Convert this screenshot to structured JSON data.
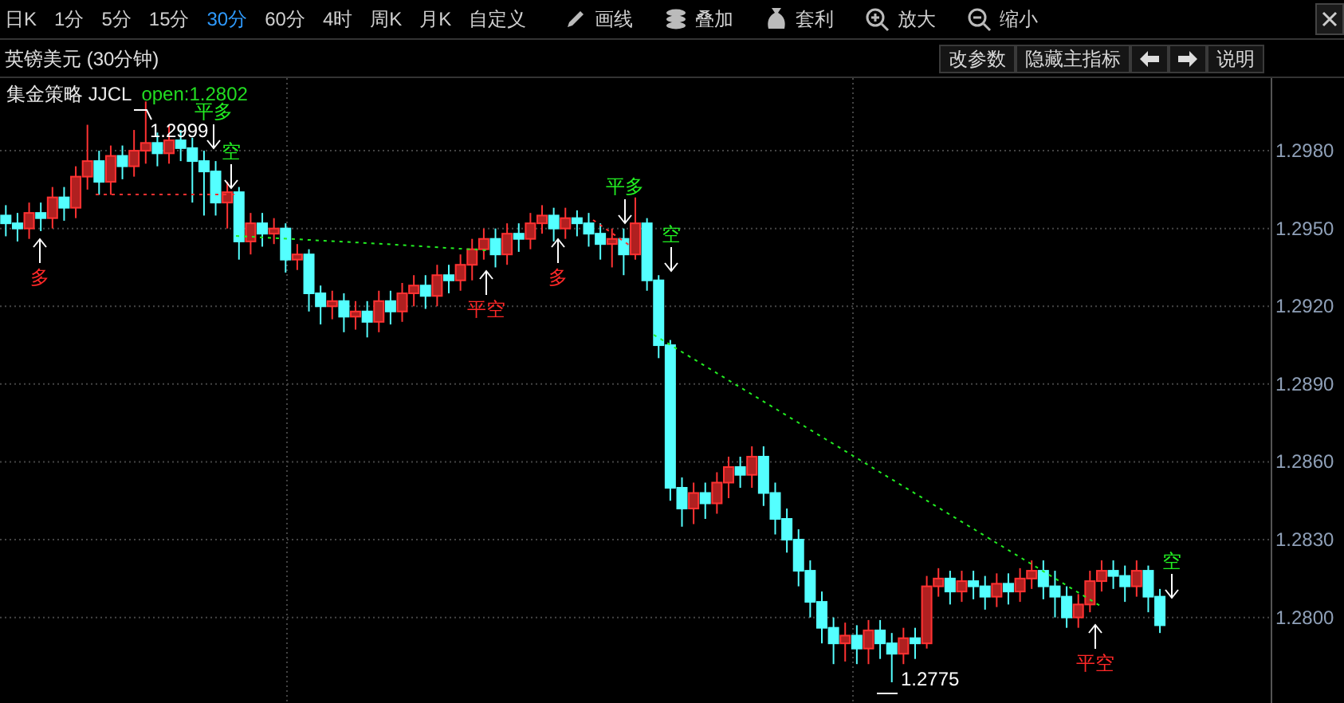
{
  "toolbar": {
    "periods": [
      {
        "label": "日K",
        "selected": false
      },
      {
        "label": "1分",
        "selected": false
      },
      {
        "label": "5分",
        "selected": false
      },
      {
        "label": "15分",
        "selected": false
      },
      {
        "label": "30分",
        "selected": true
      },
      {
        "label": "60分",
        "selected": false
      },
      {
        "label": "4时",
        "selected": false
      },
      {
        "label": "周K",
        "selected": false
      },
      {
        "label": "月K",
        "selected": false
      },
      {
        "label": "自定义",
        "selected": false
      }
    ],
    "tools": [
      {
        "label": "画线"
      },
      {
        "label": "叠加"
      },
      {
        "label": "套利"
      },
      {
        "label": "放大"
      },
      {
        "label": "缩小"
      }
    ]
  },
  "chart_header": {
    "title": "英镑美元 (30分钟)",
    "buttons": [
      "改参数",
      "隐藏主指标",
      "说明"
    ]
  },
  "indicator": {
    "name": "集金策略 JJCL",
    "value": "open:1.2802"
  },
  "chart_data": {
    "type": "candlestick",
    "grid": true,
    "ylim": [
      1.2767,
      1.3008
    ],
    "categories": [
      null,
      null,
      null,
      null,
      null,
      null,
      null,
      null,
      null,
      null,
      null,
      null,
      null,
      null,
      null,
      null,
      null,
      null,
      null,
      null,
      null,
      null,
      null,
      null,
      null,
      null,
      null,
      null,
      null,
      null,
      null,
      null,
      null,
      null,
      null,
      null,
      null,
      null,
      null,
      null,
      null,
      null,
      null,
      null,
      null,
      null,
      null,
      null,
      null,
      null,
      null,
      null,
      null,
      null,
      null,
      null,
      null,
      null,
      null,
      null,
      null,
      null,
      null,
      null,
      null,
      null,
      null,
      null,
      null,
      null,
      null,
      null,
      null,
      null,
      null,
      null,
      null,
      null,
      null,
      null,
      null,
      null,
      null,
      null,
      null,
      null,
      null,
      null,
      null,
      null,
      null,
      null,
      null,
      null,
      null,
      null,
      null,
      null,
      null,
      null,
      null,
      null,
      null,
      null,
      null,
      null,
      null,
      null,
      null
    ],
    "ohlc": [
      [
        1.2955,
        1.2959,
        1.2947,
        1.2952
      ],
      [
        1.2952,
        1.2956,
        1.2945,
        1.295
      ],
      [
        1.295,
        1.296,
        1.2946,
        1.2956
      ],
      [
        1.2956,
        1.296,
        1.2949,
        1.2954
      ],
      [
        1.2954,
        1.2966,
        1.295,
        1.2962
      ],
      [
        1.2962,
        1.2966,
        1.2953,
        1.2958
      ],
      [
        1.2958,
        1.2974,
        1.2954,
        1.297
      ],
      [
        1.297,
        1.299,
        1.2965,
        1.2976
      ],
      [
        1.2976,
        1.298,
        1.2963,
        1.2968
      ],
      [
        1.2968,
        1.2982,
        1.2963,
        1.2978
      ],
      [
        1.2978,
        1.2982,
        1.2969,
        1.2974
      ],
      [
        1.2974,
        1.2988,
        1.297,
        1.298
      ],
      [
        1.298,
        1.2999,
        1.2975,
        1.2983
      ],
      [
        1.2983,
        1.2987,
        1.2974,
        1.2979
      ],
      [
        1.2979,
        1.299,
        1.2975,
        1.2984
      ],
      [
        1.2984,
        1.2988,
        1.2976,
        1.2981
      ],
      [
        1.2981,
        1.2985,
        1.296,
        1.2976
      ],
      [
        1.2976,
        1.298,
        1.2955,
        1.2972
      ],
      [
        1.2972,
        1.2976,
        1.2955,
        1.296
      ],
      [
        1.296,
        1.2968,
        1.295,
        1.2964
      ],
      [
        1.2964,
        1.2966,
        1.2938,
        1.2945
      ],
      [
        1.2945,
        1.2956,
        1.294,
        1.2952
      ],
      [
        1.2952,
        1.2956,
        1.2943,
        1.2948
      ],
      [
        1.2948,
        1.2954,
        1.2944,
        1.295
      ],
      [
        1.295,
        1.2952,
        1.2933,
        1.2938
      ],
      [
        1.2938,
        1.2944,
        1.2934,
        1.294
      ],
      [
        1.294,
        1.2942,
        1.2918,
        1.2925
      ],
      [
        1.2925,
        1.2928,
        1.2913,
        1.292
      ],
      [
        1.292,
        1.2926,
        1.2915,
        1.2922
      ],
      [
        1.2922,
        1.2925,
        1.291,
        1.2916
      ],
      [
        1.2916,
        1.2922,
        1.2911,
        1.2918
      ],
      [
        1.2918,
        1.2922,
        1.2908,
        1.2914
      ],
      [
        1.2914,
        1.2926,
        1.291,
        1.2922
      ],
      [
        1.2922,
        1.2926,
        1.2913,
        1.2918
      ],
      [
        1.2918,
        1.2929,
        1.2914,
        1.2925
      ],
      [
        1.2925,
        1.2932,
        1.292,
        1.2928
      ],
      [
        1.2928,
        1.2932,
        1.2919,
        1.2924
      ],
      [
        1.2924,
        1.2936,
        1.292,
        1.2932
      ],
      [
        1.2932,
        1.2936,
        1.2925,
        1.293
      ],
      [
        1.293,
        1.294,
        1.2926,
        1.2936
      ],
      [
        1.2936,
        1.2946,
        1.293,
        1.2942
      ],
      [
        1.2942,
        1.295,
        1.2938,
        1.2946
      ],
      [
        1.2946,
        1.295,
        1.2935,
        1.294
      ],
      [
        1.294,
        1.2952,
        1.2936,
        1.2948
      ],
      [
        1.2948,
        1.2952,
        1.2941,
        1.2946
      ],
      [
        1.2946,
        1.2956,
        1.2942,
        1.2952
      ],
      [
        1.2952,
        1.2959,
        1.2948,
        1.2955
      ],
      [
        1.2955,
        1.2958,
        1.2945,
        1.295
      ],
      [
        1.295,
        1.2958,
        1.2946,
        1.2954
      ],
      [
        1.2954,
        1.2957,
        1.2947,
        1.2952
      ],
      [
        1.2952,
        1.2956,
        1.2943,
        1.2948
      ],
      [
        1.2948,
        1.2952,
        1.2938,
        1.2944
      ],
      [
        1.2944,
        1.295,
        1.2935,
        1.2946
      ],
      [
        1.2946,
        1.295,
        1.2932,
        1.294
      ],
      [
        1.294,
        1.2962,
        1.2938,
        1.2952
      ],
      [
        1.2952,
        1.2954,
        1.2926,
        1.293
      ],
      [
        1.293,
        1.2932,
        1.29,
        1.2905
      ],
      [
        1.2905,
        1.2907,
        1.2845,
        1.285
      ],
      [
        1.285,
        1.2854,
        1.2835,
        1.2842
      ],
      [
        1.2842,
        1.2852,
        1.2836,
        1.2848
      ],
      [
        1.2848,
        1.2852,
        1.2838,
        1.2844
      ],
      [
        1.2844,
        1.2856,
        1.284,
        1.2852
      ],
      [
        1.2852,
        1.2862,
        1.2846,
        1.2858
      ],
      [
        1.2858,
        1.2862,
        1.285,
        1.2855
      ],
      [
        1.2855,
        1.2866,
        1.285,
        1.2862
      ],
      [
        1.2862,
        1.2866,
        1.2843,
        1.2848
      ],
      [
        1.2848,
        1.2852,
        1.2832,
        1.2838
      ],
      [
        1.2838,
        1.2842,
        1.2825,
        1.283
      ],
      [
        1.283,
        1.2834,
        1.2812,
        1.2818
      ],
      [
        1.2818,
        1.2822,
        1.28,
        1.2806
      ],
      [
        1.2806,
        1.281,
        1.279,
        1.2796
      ],
      [
        1.2796,
        1.28,
        1.2782,
        1.279
      ],
      [
        1.279,
        1.2798,
        1.2783,
        1.2793
      ],
      [
        1.2793,
        1.2797,
        1.2782,
        1.2788
      ],
      [
        1.2788,
        1.2799,
        1.2782,
        1.2795
      ],
      [
        1.2795,
        1.2799,
        1.2784,
        1.279
      ],
      [
        1.279,
        1.2794,
        1.2775,
        1.2786
      ],
      [
        1.2786,
        1.2796,
        1.2782,
        1.2792
      ],
      [
        1.2792,
        1.2796,
        1.2784,
        1.279
      ],
      [
        1.279,
        1.2816,
        1.2788,
        1.2812
      ],
      [
        1.2812,
        1.2819,
        1.2808,
        1.2815
      ],
      [
        1.2815,
        1.2818,
        1.2805,
        1.281
      ],
      [
        1.281,
        1.2818,
        1.2806,
        1.2814
      ],
      [
        1.2814,
        1.2818,
        1.2807,
        1.2812
      ],
      [
        1.2812,
        1.2816,
        1.2803,
        1.2808
      ],
      [
        1.2808,
        1.2817,
        1.2804,
        1.2813
      ],
      [
        1.2813,
        1.2817,
        1.2805,
        1.281
      ],
      [
        1.281,
        1.2819,
        1.2806,
        1.2815
      ],
      [
        1.2815,
        1.2822,
        1.2811,
        1.2818
      ],
      [
        1.2818,
        1.2822,
        1.2807,
        1.2812
      ],
      [
        1.2812,
        1.2818,
        1.28,
        1.2808
      ],
      [
        1.2808,
        1.2812,
        1.2796,
        1.28
      ],
      [
        1.28,
        1.2809,
        1.2796,
        1.2805
      ],
      [
        1.2805,
        1.2818,
        1.2802,
        1.2814
      ],
      [
        1.2814,
        1.2822,
        1.281,
        1.2818
      ],
      [
        1.2818,
        1.2822,
        1.2811,
        1.2816
      ],
      [
        1.2816,
        1.282,
        1.2806,
        1.2812
      ],
      [
        1.2812,
        1.2822,
        1.2808,
        1.2818
      ],
      [
        1.2818,
        1.282,
        1.2802,
        1.2808
      ],
      [
        1.2808,
        1.2811,
        1.2794,
        1.2797
      ],
      null,
      null,
      null,
      null,
      null,
      null,
      null,
      null,
      null
    ],
    "yticks": [
      {
        "value": 1.298,
        "label": "1.2980"
      },
      {
        "value": 1.295,
        "label": "1.2950"
      },
      {
        "value": 1.292,
        "label": "1.2920"
      },
      {
        "value": 1.289,
        "label": "1.2890"
      },
      {
        "value": 1.286,
        "label": "1.2860"
      },
      {
        "value": 1.283,
        "label": "1.2830"
      },
      {
        "value": 1.28,
        "label": "1.2800"
      }
    ]
  },
  "signals": [
    {
      "label": "多",
      "kind": "buy"
    },
    {
      "label": "平多",
      "kind": "sell"
    },
    {
      "label": "空",
      "kind": "sell"
    },
    {
      "label": "平空",
      "kind": "buy"
    },
    {
      "label": "多",
      "kind": "buy"
    },
    {
      "label": "平多",
      "kind": "sell"
    },
    {
      "label": "空",
      "kind": "sell"
    },
    {
      "label": "平空",
      "kind": "buy"
    },
    {
      "label": "空",
      "kind": "sell"
    }
  ],
  "price_marks": [
    {
      "text": "1.2999",
      "kind": "high"
    },
    {
      "text": "1.2775",
      "kind": "low"
    }
  ]
}
